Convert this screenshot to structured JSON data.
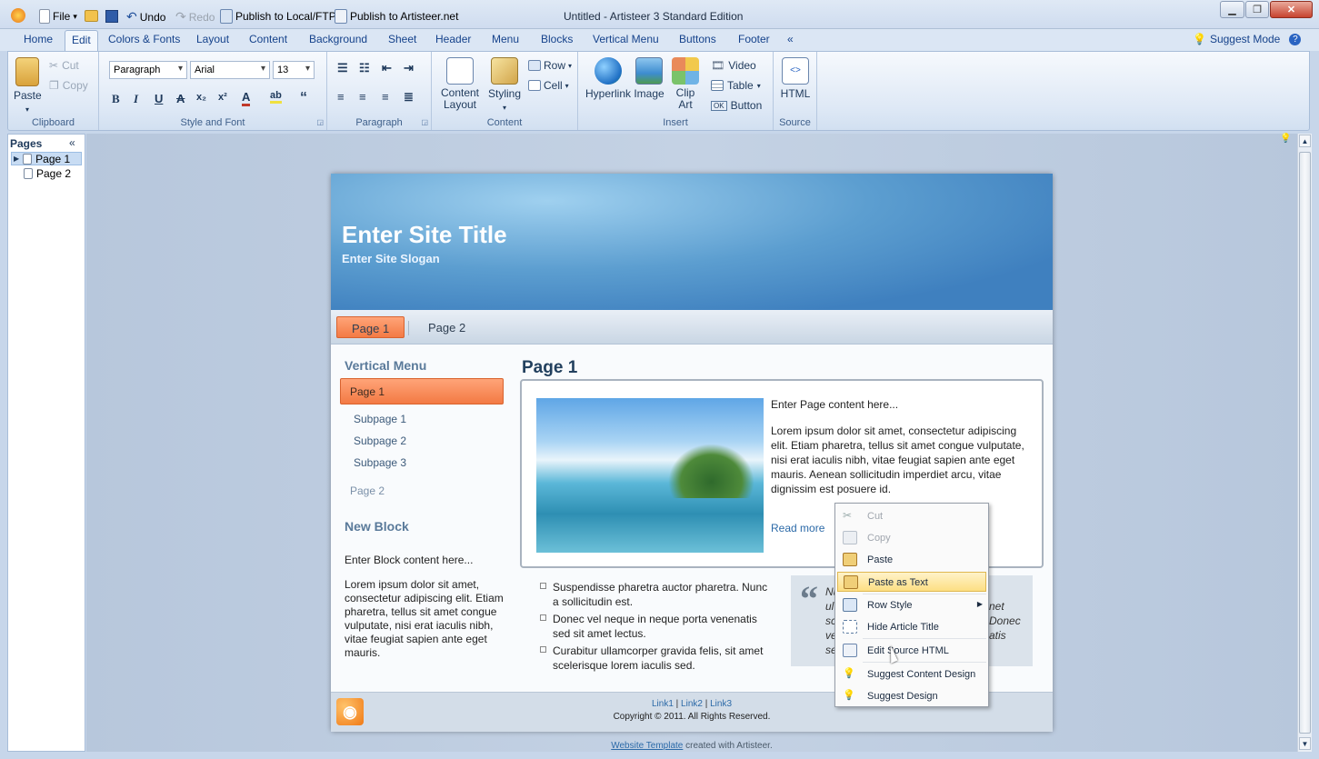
{
  "titlebar": {
    "title": "Untitled - Artisteer 3 Standard Edition",
    "file": "File",
    "undo": "Undo",
    "redo": "Redo",
    "publish_local": "Publish to Local/FTP",
    "publish_artisteer": "Publish to Artisteer.net"
  },
  "tabs": [
    "Home",
    "Edit",
    "Colors & Fonts",
    "Layout",
    "Content",
    "Background",
    "Sheet",
    "Header",
    "Menu",
    "Blocks",
    "Vertical Menu",
    "Buttons",
    "Footer"
  ],
  "tabs_more": "«",
  "suggest_mode": "Suggest Mode",
  "ribbon": {
    "clipboard": {
      "label": "Clipboard",
      "paste": "Paste",
      "cut": "Cut",
      "copy": "Copy"
    },
    "style_font": {
      "label": "Style and Font",
      "style": "Paragraph",
      "font": "Arial",
      "size": "13"
    },
    "paragraph": {
      "label": "Paragraph"
    },
    "content": {
      "label": "Content",
      "content_layout": "Content Layout",
      "styling": "Styling",
      "row": "Row",
      "cell": "Cell"
    },
    "insert": {
      "label": "Insert",
      "hyperlink": "Hyperlink",
      "image": "Image",
      "clip_art": "Clip Art",
      "video": "Video",
      "table": "Table",
      "button": "Button"
    },
    "source": {
      "label": "Source",
      "html": "HTML"
    }
  },
  "pages_panel": {
    "title": "Pages",
    "collapse": "«",
    "items": [
      "Page 1",
      "Page 2"
    ]
  },
  "site": {
    "title": "Enter Site Title",
    "slogan": "Enter Site Slogan",
    "menu": [
      "Page 1",
      "Page 2"
    ],
    "vmenu": {
      "title": "Vertical Menu",
      "items": [
        "Page 1",
        "Subpage 1",
        "Subpage 2",
        "Subpage 3",
        "Page 2"
      ]
    },
    "block": {
      "title": "New Block",
      "intro": "Enter Block content here...",
      "text": "Lorem ipsum dolor sit amet, consectetur adipiscing elit. Etiam pharetra, tellus sit amet congue vulputate, nisi erat iaculis nibh, vitae feugiat sapien ante eget mauris."
    },
    "article": {
      "title": "Page 1",
      "intro": "Enter Page content here...",
      "text": "Lorem ipsum dolor sit amet, consectetur adipiscing elit. Etiam pharetra, tellus sit amet congue vulputate, nisi erat iaculis nibh, vitae feugiat sapien ante eget mauris. Aenean sollicitudin imperdiet arcu, vitae dignissim est posuere id.",
      "read_more": "Read more"
    },
    "bullets": [
      "Suspendisse pharetra auctor pharetra. Nunc a sollicitudin est.",
      "Donec vel neque in neque porta venenatis sed sit amet lectus.",
      "Curabitur ullamcorper gravida felis, sit amet scelerisque lorem iaculis sed."
    ],
    "quote_fragments": [
      "Nu",
      "ul",
      "sc",
      "ve",
      "se",
      "net",
      "Donec",
      "atis"
    ],
    "footer": {
      "link1": "Link1",
      "link2": "Link2",
      "link3": "Link3",
      "sep": "|",
      "copyright": "Copyright © 2011. All Rights Reserved."
    },
    "credit_link": "Website Template",
    "credit_text": "created with Artisteer."
  },
  "context_menu": [
    "Cut",
    "Copy",
    "Paste",
    "Paste as Text",
    "Row Style",
    "Hide Article Title",
    "Edit Source HTML",
    "Suggest Content Design",
    "Suggest Design"
  ],
  "colors": {
    "accent": "#f37a44",
    "ribbon": "#dfe9f6",
    "highlight": "#fddf83"
  }
}
